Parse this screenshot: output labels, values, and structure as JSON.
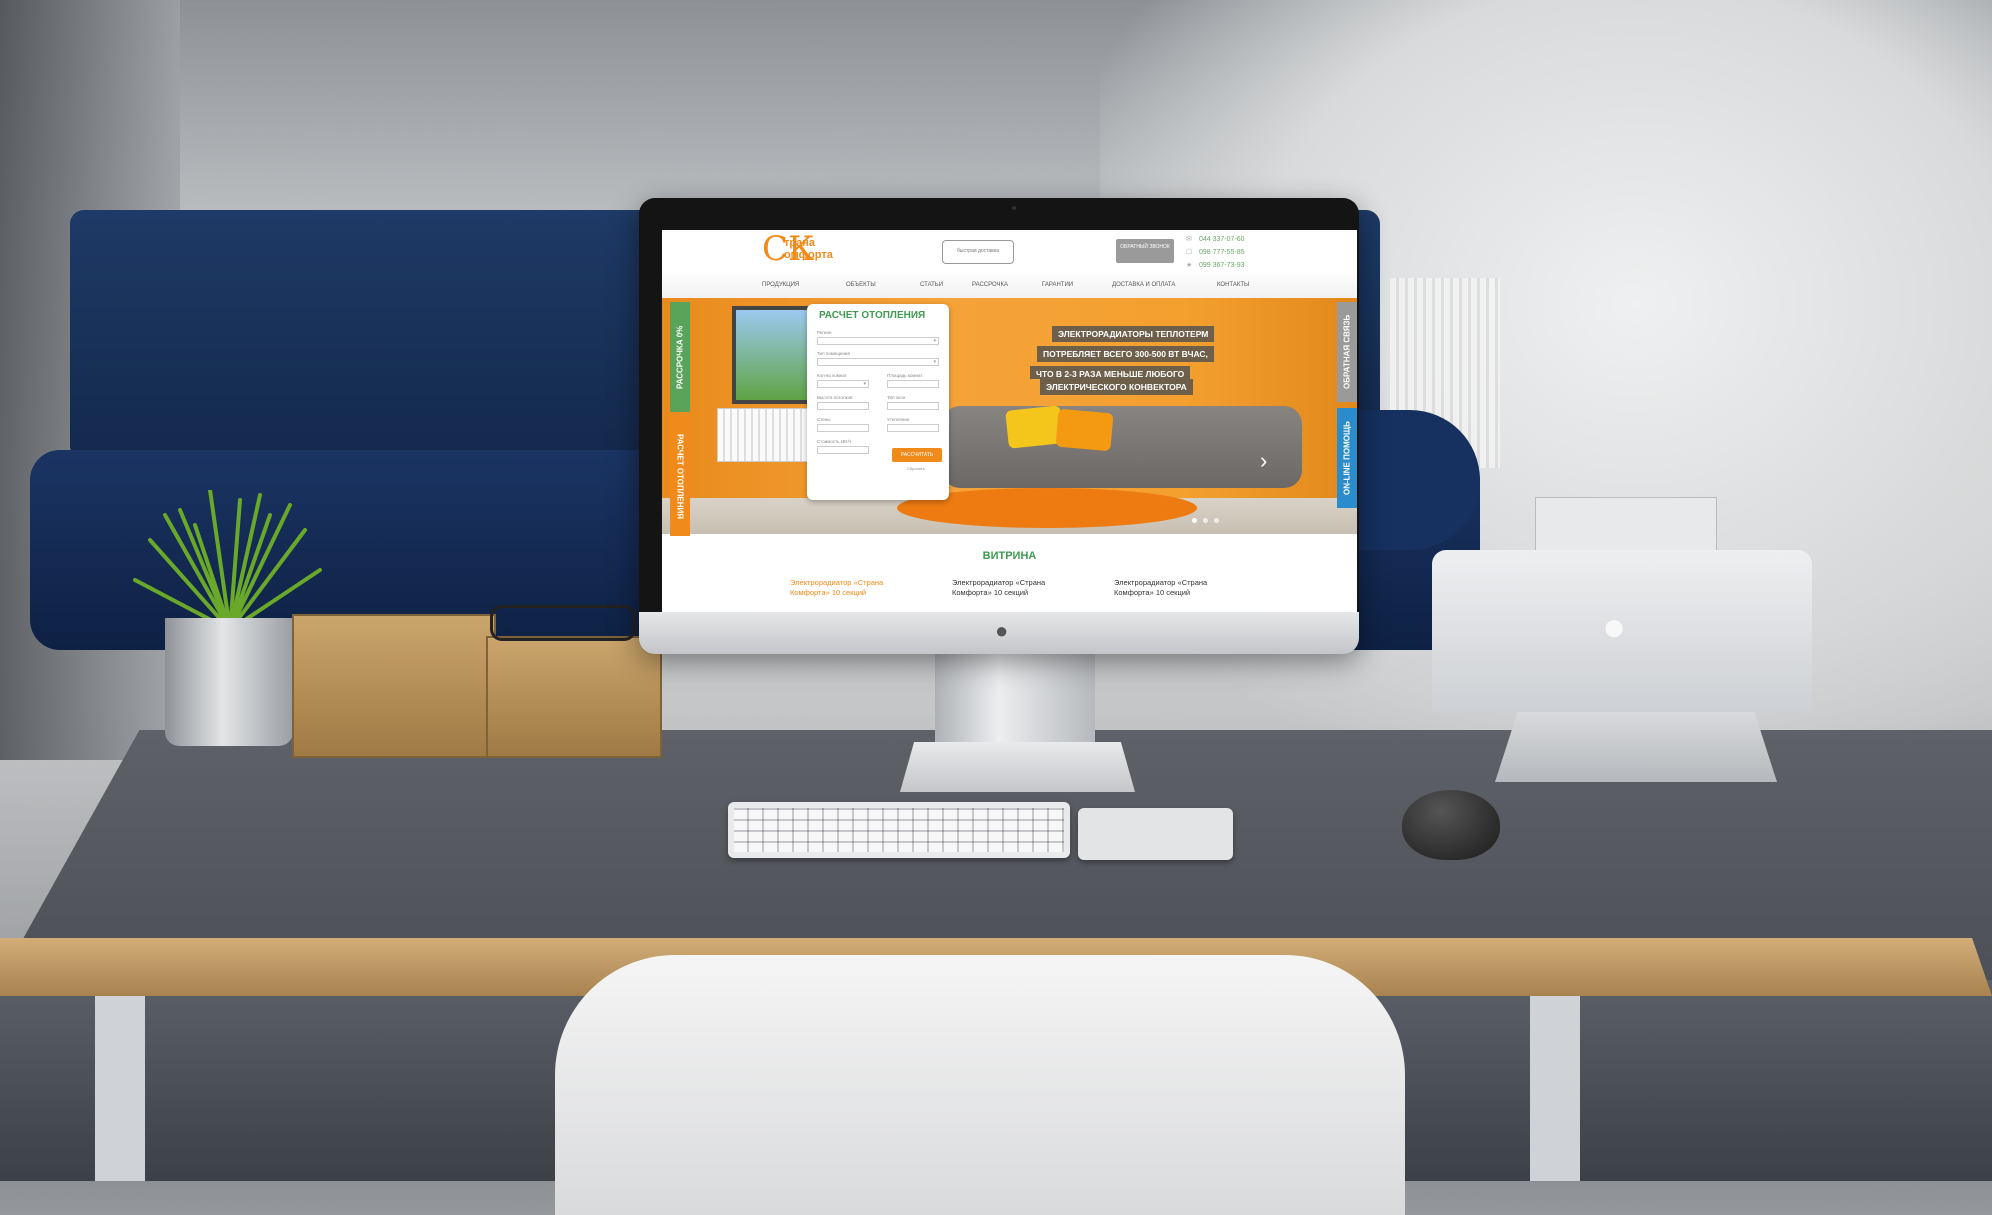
{
  "site": {
    "logo_mark": "СК",
    "logo_line1": "трана",
    "logo_line2": "омфорта",
    "truck_text": "быстрая доставка",
    "callback_label": "ОБРАТНЫЙ ЗВОНОК",
    "phones": [
      "044 337-07-60",
      "098 777-55-85",
      "099 367-73-93"
    ],
    "nav": [
      "ПРОДУКЦИЯ",
      "ОБЪЕКТЫ",
      "СТАТЬИ",
      "РАССРОЧКА",
      "ГАРАНТИИ",
      "ДОСТАВКА И ОПЛАТА",
      "КОНТАКТЫ"
    ],
    "side_tabs": {
      "left_top": "РАССРОЧКА 0%",
      "left_bottom": "РАСЧЕТ ОТОПЛЕНИЯ",
      "right_top": "ОБРАТНАЯ СВЯЗЬ",
      "right_bottom": "ON-LINE ПОМОЩЬ"
    },
    "calculator": {
      "title": "РАСЧЕТ ОТОПЛЕНИЯ",
      "labels": [
        "Регион",
        "Тип помещения",
        "Кол-во комнат",
        "Площадь комнат",
        "Высота потолков",
        "Тип окон",
        "Стены",
        "Утепление",
        "Стоимость кВт/ч"
      ],
      "submit": "РАССЧИТАТЬ",
      "reset_link": "Сбросить"
    },
    "captions": [
      "ЭЛЕКТРОРАДИАТОРЫ ТЕПЛОТЕРМ",
      "ПОТРЕБЛЯЕТ ВСЕГО 300-500 ВТ ВЧАС,",
      "ЧТО В 2-3 РАЗА МЕНЬШЕ ЛЮБОГО",
      "ЭЛЕКТРИЧЕСКОГО КОНВЕКТОРА"
    ],
    "slider_dots": 3,
    "showcase_title": "ВИТРИНА",
    "products": [
      "Электрорадиатор «Страна Комфорта» 10 секций",
      "Электрорадиатор «Страна Комфорта» 10 секций",
      "Электрорадиатор «Страна Комфорта» 10 секций"
    ]
  },
  "colors": {
    "accent_orange": "#f08a1a",
    "accent_green": "#3f9a52",
    "accent_blue": "#2a8ccc"
  }
}
